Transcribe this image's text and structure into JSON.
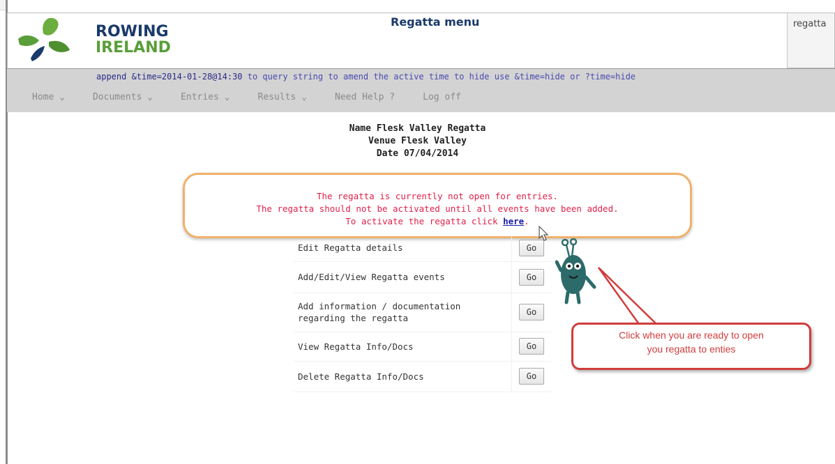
{
  "header": {
    "logo_line1": "ROWING",
    "logo_line2": "IRELAND",
    "title": "Regatta menu",
    "right_text": "regatta"
  },
  "notice": {
    "prefix": "append &time=2014-01-28@14:30",
    "rest": " to query string to amend the active time to hide use &time=hide or ?time=hide"
  },
  "nav": {
    "items": [
      {
        "label": "Home ⌄"
      },
      {
        "label": "Documents ⌄"
      },
      {
        "label": "Entries ⌄"
      },
      {
        "label": "Results ⌄"
      },
      {
        "label": "Need Help ?"
      },
      {
        "label": "Log off"
      }
    ]
  },
  "regatta": {
    "name": "Name Flesk Valley Regatta",
    "venue": "Venue Flesk Valley",
    "date": "Date 07/04/2014"
  },
  "warning": {
    "line1": "The regatta is currently not open for entries.",
    "line2": "The regatta should not be activated until all events have been added.",
    "line3_prefix": "To activate the regatta click ",
    "link": "here",
    "line3_suffix": "."
  },
  "actions": [
    {
      "label": "Edit Regatta details",
      "button": "Go"
    },
    {
      "label": "Add/Edit/View Regatta events",
      "button": "Go"
    },
    {
      "label": "Add information / documentation regarding the regatta",
      "button": "Go"
    },
    {
      "label": "View Regatta Info/Docs",
      "button": "Go"
    },
    {
      "label": "Delete Regatta Info/Docs",
      "button": "Go"
    }
  ],
  "callout": {
    "line1": "Click when you are ready to open",
    "line2": "you regatta to enties"
  },
  "colors": {
    "warning_text": "#e0204a",
    "link": "#1a1aa8",
    "box_border": "#f0b16a",
    "callout": "#d03c3c",
    "brand_blue": "#1a3a6b",
    "brand_green": "#5a9e3a"
  }
}
